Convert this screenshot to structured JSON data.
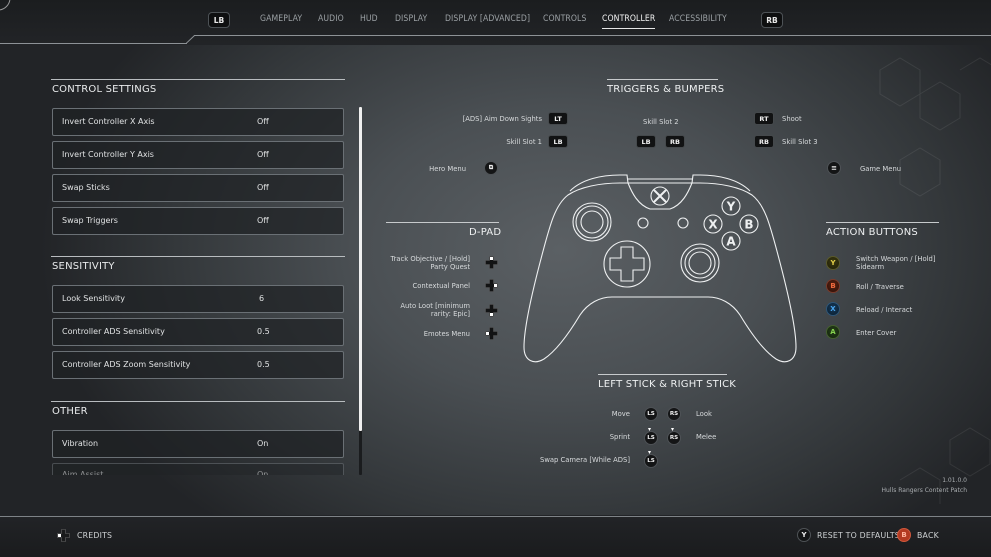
{
  "topnav": {
    "left_bumper": "LB",
    "right_bumper": "RB",
    "tabs": [
      {
        "label": "GAMEPLAY",
        "active": false
      },
      {
        "label": "AUDIO",
        "active": false
      },
      {
        "label": "HUD",
        "active": false
      },
      {
        "label": "DISPLAY",
        "active": false
      },
      {
        "label": "DISPLAY [ADVANCED]",
        "active": false
      },
      {
        "label": "CONTROLS",
        "active": false
      },
      {
        "label": "CONTROLLER",
        "active": true
      },
      {
        "label": "ACCESSIBILITY",
        "active": false
      }
    ]
  },
  "settings": {
    "control": {
      "title": "CONTROL SETTINGS",
      "rows": [
        {
          "label": "Invert Controller X Axis",
          "value": "Off"
        },
        {
          "label": "Invert Controller Y Axis",
          "value": "Off"
        },
        {
          "label": "Swap Sticks",
          "value": "Off"
        },
        {
          "label": "Swap Triggers",
          "value": "Off"
        }
      ]
    },
    "sensitivity": {
      "title": "SENSITIVITY",
      "rows": [
        {
          "label": "Look Sensitivity",
          "value": "6"
        },
        {
          "label": "Controller ADS Sensitivity",
          "value": "0.5"
        },
        {
          "label": "Controller ADS Zoom Sensitivity",
          "value": "0.5"
        }
      ]
    },
    "other": {
      "title": "OTHER",
      "rows": [
        {
          "label": "Vibration",
          "value": "On"
        },
        {
          "label": "Aim Assist",
          "value": "On"
        }
      ]
    },
    "scroll_fraction_visible": 0.88
  },
  "triggers_bumpers": {
    "title": "TRIGGERS & BUMPERS",
    "aim_label": "[ADS] Aim Down Sights",
    "lt": "LT",
    "skill1_label": "Skill Slot 1",
    "lb": "LB",
    "skill2_label": "Skill Slot 2",
    "rb": "RB",
    "rt": "RT",
    "shoot_label": "Shoot",
    "skill3_label": "Skill Slot 3"
  },
  "menus": {
    "hero_menu": "Hero Menu",
    "game_menu": "Game Menu"
  },
  "dpad": {
    "title": "D-PAD",
    "items": [
      {
        "label_line1": "Track Objective / [Hold]",
        "label_line2": "Party Quest",
        "dir": "up"
      },
      {
        "label_line1": "Contextual Panel",
        "label_line2": "",
        "dir": "right"
      },
      {
        "label_line1": "Auto Loot [minimum",
        "label_line2": "rarity: Epic]",
        "dir": "down"
      },
      {
        "label_line1": "Emotes Menu",
        "label_line2": "",
        "dir": "left"
      }
    ]
  },
  "action_buttons": {
    "title": "ACTION BUTTONS",
    "items": [
      {
        "button": "Y",
        "label_line1": "Switch Weapon / [Hold]",
        "label_line2": "Sidearm"
      },
      {
        "button": "B",
        "label_line1": "Roll / Traverse",
        "label_line2": ""
      },
      {
        "button": "X",
        "label_line1": "Reload / Interact",
        "label_line2": ""
      },
      {
        "button": "A",
        "label_line1": "Enter Cover",
        "label_line2": ""
      }
    ]
  },
  "sticks": {
    "title": "LEFT STICK & RIGHT STICK",
    "move": "Move",
    "look": "Look",
    "sprint": "Sprint",
    "melee": "Melee",
    "swap_camera": "Swap Camera [While ADS]",
    "ls": "LS",
    "rs": "RS"
  },
  "controller_diagram": {
    "y": "Y",
    "x": "X",
    "b": "B",
    "a": "A"
  },
  "version": {
    "number": "1.01.0.0",
    "name": "Hulls Rangers Content Patch"
  },
  "footer": {
    "credits": "CREDITS",
    "reset_button": "Y",
    "reset": "RESET TO DEFAULTS",
    "back_button": "B",
    "back": "BACK"
  },
  "colors": {
    "y_button": "#e6d14a",
    "b_button": "#f06a3e",
    "x_button": "#4aa6f0",
    "a_button": "#86d24e"
  }
}
